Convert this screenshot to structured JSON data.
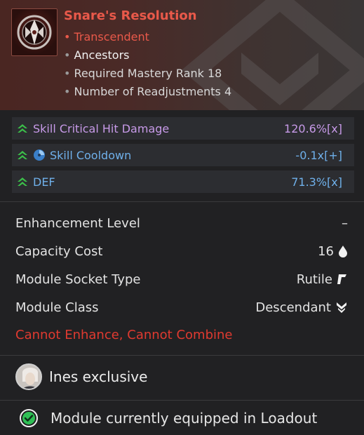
{
  "module": {
    "name": "Snare's Resolution",
    "tier": "Transcendent",
    "category": "Ancestors",
    "mastery": "Required Mastery Rank 18",
    "readjust": "Number of Readjustments 4"
  },
  "stats": [
    {
      "label": "Skill Critical Hit Damage",
      "value": "120.6%[x]",
      "color": "#c79ae8"
    },
    {
      "label": "Skill Cooldown",
      "value": "-0.1x[+]",
      "color": "#6fb0ea"
    },
    {
      "label": "DEF",
      "value": "71.3%[x]",
      "color": "#6fb0ea"
    }
  ],
  "props": {
    "enhancement_label": "Enhancement Level",
    "enhancement_value": "–",
    "capacity_label": "Capacity Cost",
    "capacity_value": "16",
    "socket_label": "Module Socket Type",
    "socket_value": "Rutile",
    "class_label": "Module Class",
    "class_value": "Descendant"
  },
  "warning": "Cannot Enhance, Cannot Combine",
  "exclusive": "Ines exclusive",
  "equipped": "Module currently equipped in Loadout",
  "icons": {
    "module": "module-emblem-icon",
    "upgrade": "double-chevron-up-icon",
    "cooldown": "cooldown-icon",
    "capacity": "drop-icon",
    "socket": "rutile-socket-icon",
    "class": "descendant-class-icon",
    "check": "check-circle-icon"
  },
  "colors": {
    "title": "#e9594a",
    "warning": "#e03a30",
    "upgrade": "#3cbf4a",
    "check": "#2fbf55"
  }
}
